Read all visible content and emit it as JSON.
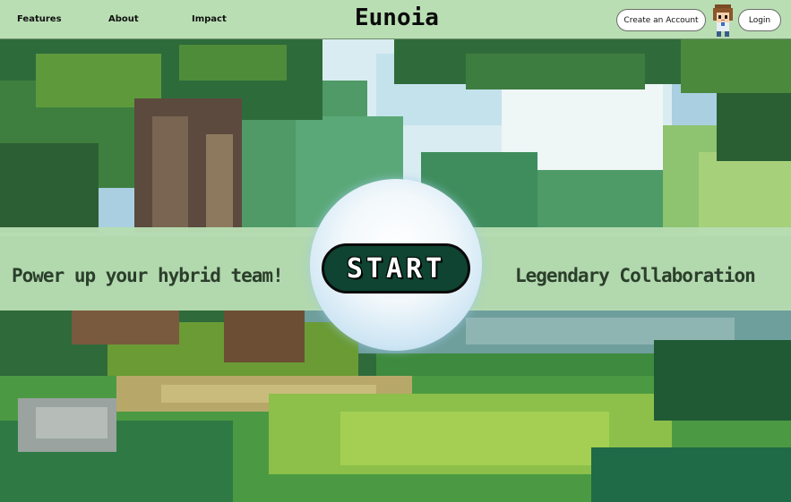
{
  "nav": {
    "links": [
      "Features",
      "About",
      "Impact"
    ],
    "logo": "Eunoia",
    "create_account_label": "Create an Account",
    "login_label": "Login"
  },
  "hero": {
    "tagline_left": "Power up your hybrid team!",
    "start_label": "START",
    "tagline_right": "Legendary Collaboration"
  },
  "colors": {
    "nav_bg": "#b9deb3",
    "band_bg": "#b7dcb2",
    "start_bg": "#0e4431",
    "tagline_text": "#2b3f2b"
  },
  "icons": {
    "avatar": "pixel-character-avatar"
  }
}
